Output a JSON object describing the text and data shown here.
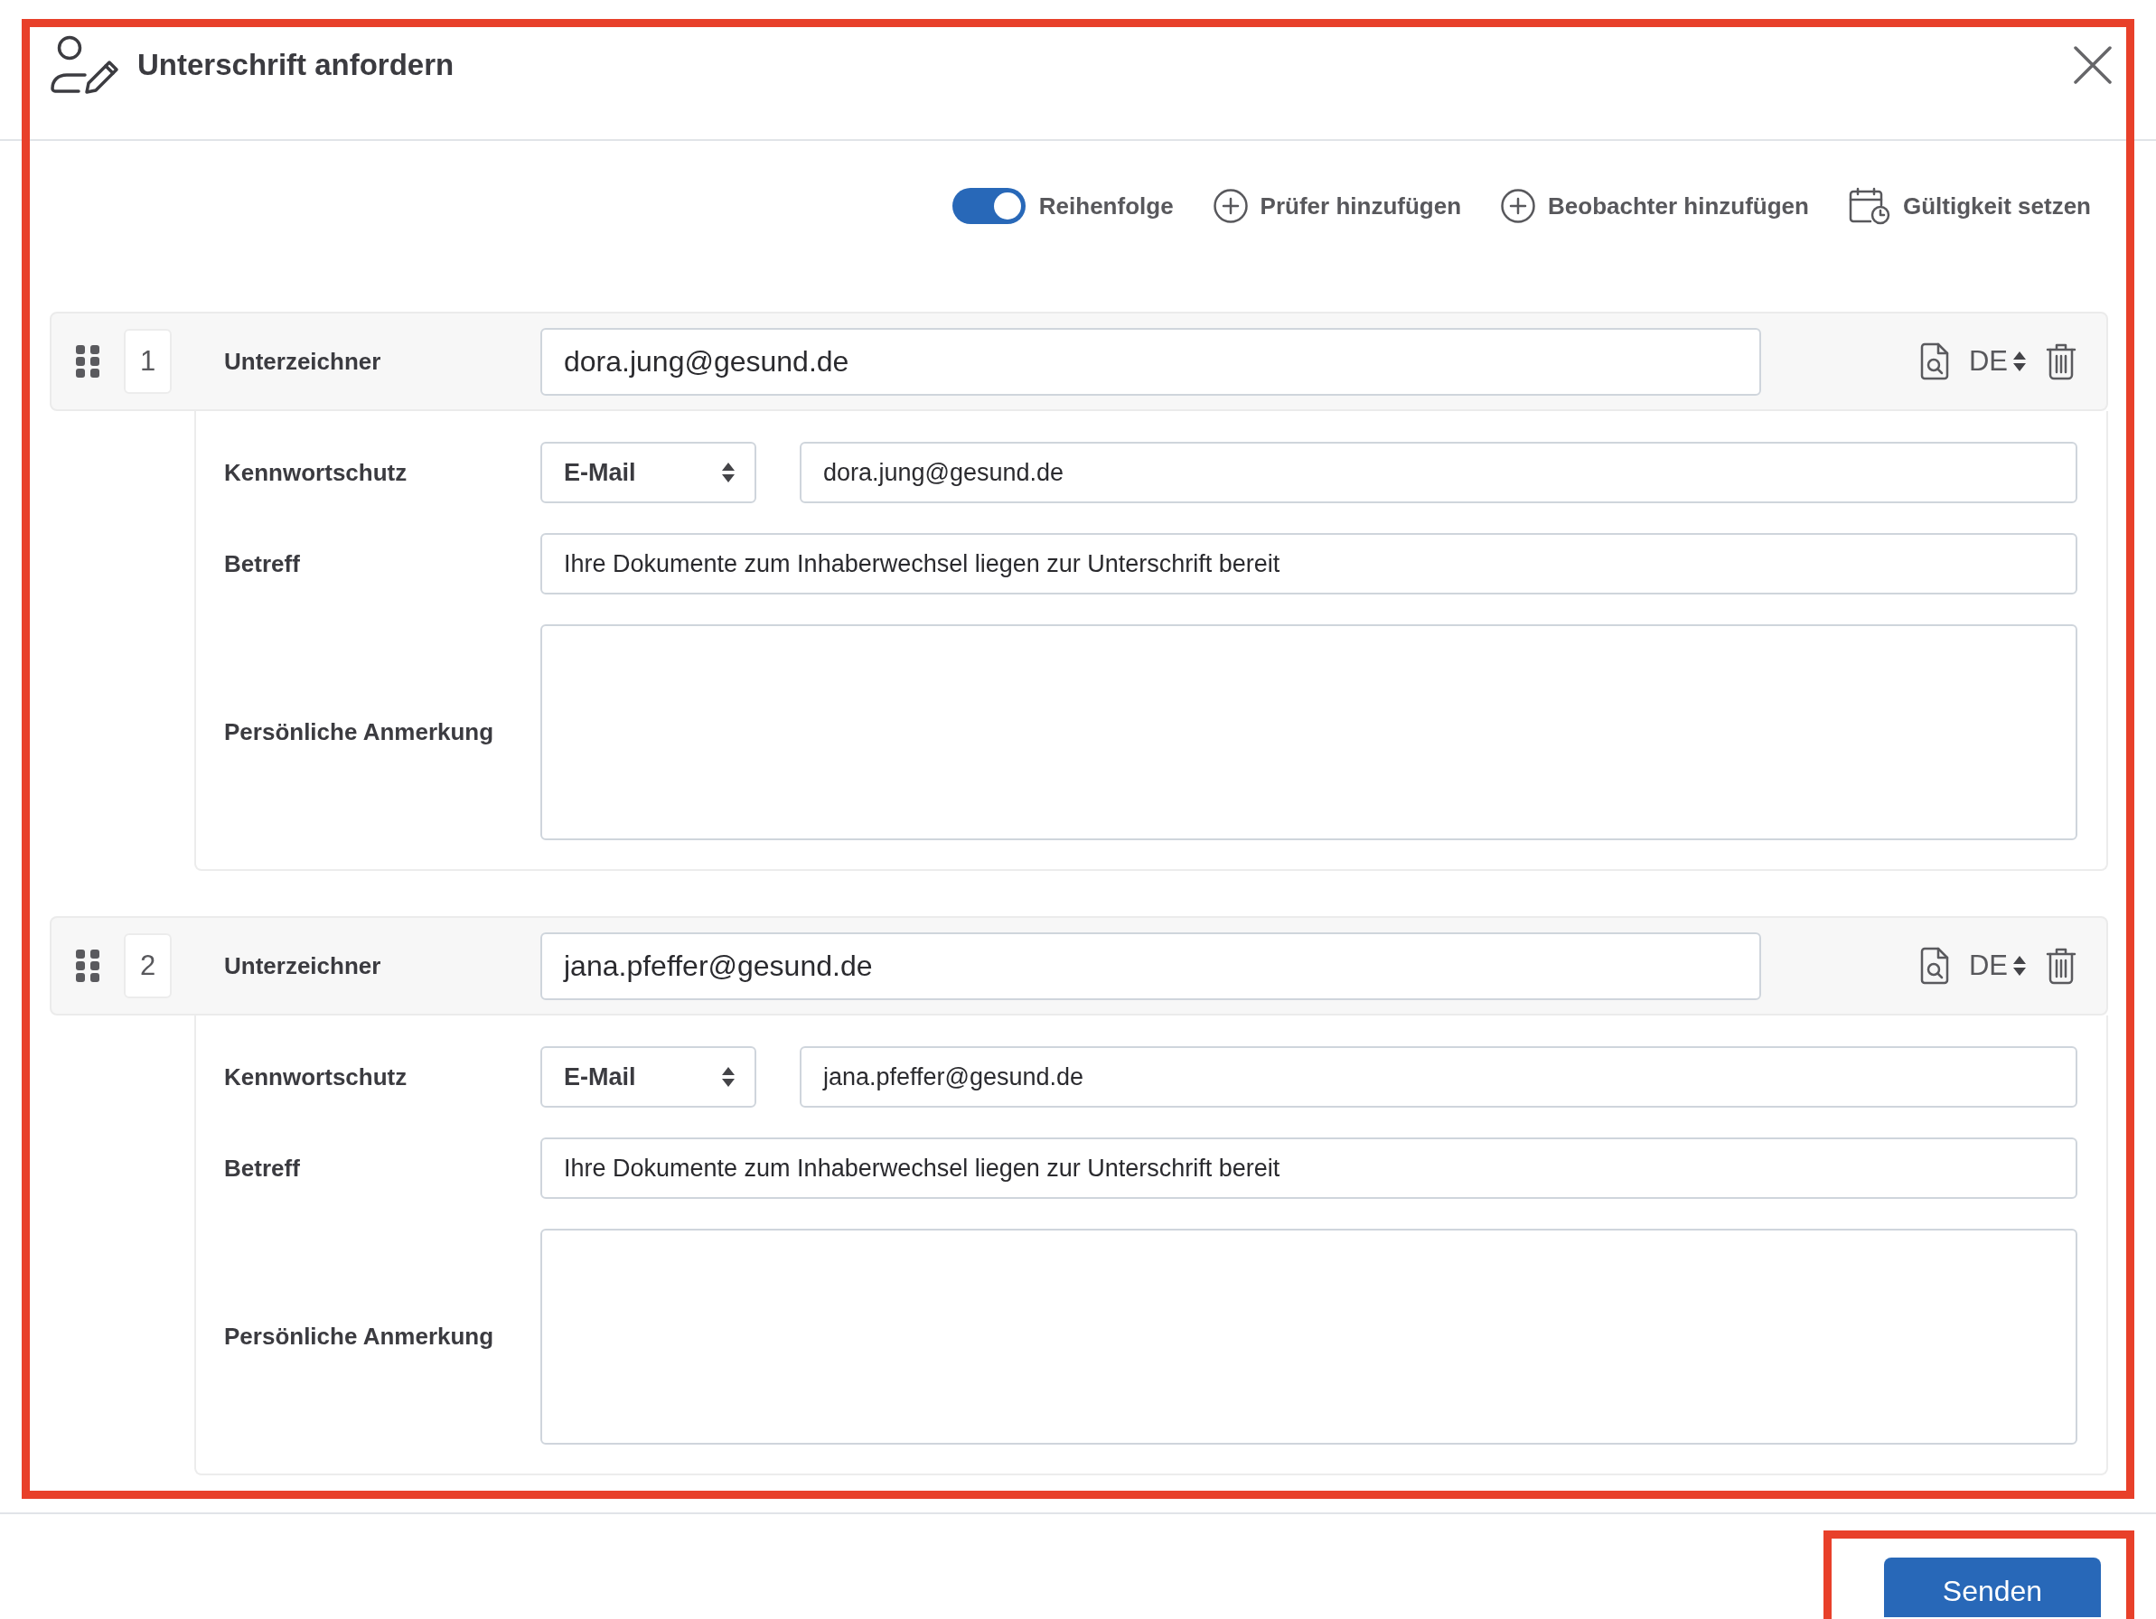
{
  "dialog": {
    "title": "Unterschrift anfordern",
    "highlighted": true
  },
  "toolbar": {
    "order_toggle": {
      "label": "Reihenfolge",
      "on": true
    },
    "actions": [
      {
        "kind": "add",
        "label": "Prüfer hinzufügen"
      },
      {
        "kind": "add",
        "label": "Beobachter hinzufügen"
      },
      {
        "kind": "validity",
        "label": "Gültigkeit setzen"
      }
    ]
  },
  "signers": [
    {
      "number": "1",
      "role_label": "Unterzeichner",
      "email": "dora.jung@gesund.de",
      "language": "DE",
      "fields": [
        {
          "kind": "password",
          "label": "Kennwortschutz",
          "method": "E-Mail",
          "value": "dora.jung@gesund.de"
        },
        {
          "kind": "text",
          "label": "Betreff",
          "value": "Ihre Dokumente zum Inhaberwechsel liegen zur Unterschrift bereit"
        },
        {
          "kind": "note",
          "label": "Persönliche Anmerkung"
        }
      ]
    },
    {
      "number": "2",
      "role_label": "Unterzeichner",
      "email": "jana.pfeffer@gesund.de",
      "language": "DE",
      "fields": [
        {
          "kind": "password",
          "label": "Kennwortschutz",
          "method": "E-Mail",
          "value": "jana.pfeffer@gesund.de"
        },
        {
          "kind": "text",
          "label": "Betreff",
          "value": "Ihre Dokumente zum Inhaberwechsel liegen zur Unterschrift bereit"
        },
        {
          "kind": "note",
          "label": "Persönliche Anmerkung"
        }
      ]
    }
  ],
  "footer": {
    "send_button": "Senden",
    "highlighted": true
  }
}
